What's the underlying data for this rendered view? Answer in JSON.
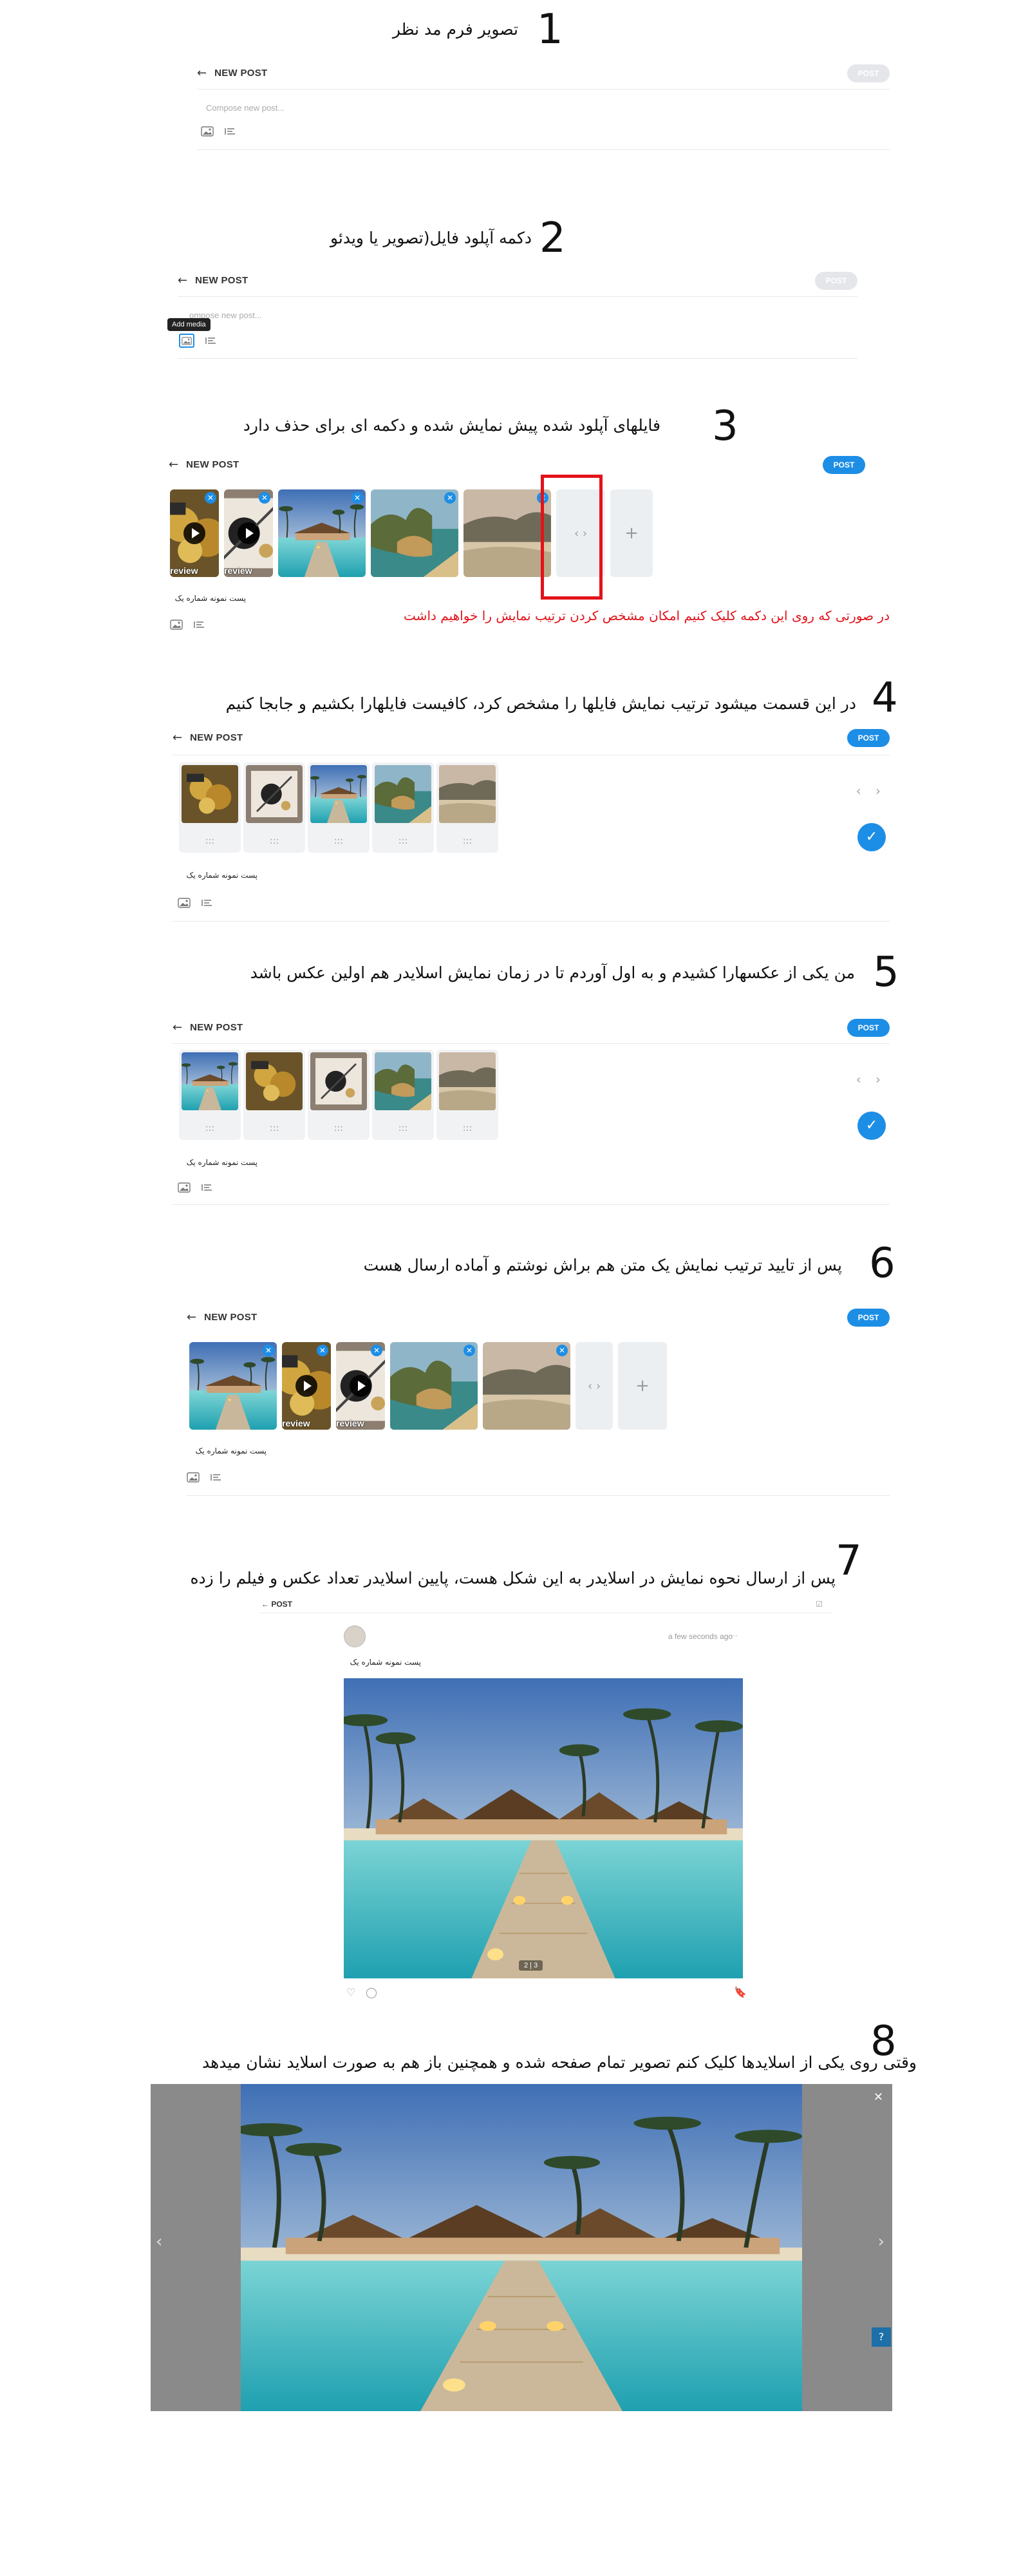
{
  "steps": [
    {
      "num": "1",
      "caption": "تصویر فرم مد نظر"
    },
    {
      "num": "2",
      "caption": "دکمه آپلود فایل(تصویر یا ویدئو"
    },
    {
      "num": "3",
      "caption": "فایلهای آپلود شده پیش نمایش شده و دکمه ای برای حذف دارد"
    },
    {
      "num": "4",
      "caption": "در این قسمت میشود ترتیب نمایش فایلها را مشخص کرد، کافیست فایلهارا بکشیم و جابجا کنیم"
    },
    {
      "num": "5",
      "caption": "من یکی از عکسهارا کشیدم و به اول آوردم تا در زمان نمایش اسلایدر هم اولین عکس باشد"
    },
    {
      "num": "6",
      "caption": "پس از تایید ترتیب نمایش یک متن هم براش نوشتم و آماده ارسال هست"
    },
    {
      "num": "7",
      "caption": "پس از ارسال نحوه نمایش در اسلایدر به این شکل هست، پایین اسلایدر تعداد عکس و فیلم را زده"
    },
    {
      "num": "8",
      "caption": "وقتی روی یکی از اسلایدها کلیک کنم تصویر تمام صفحه شده و همچنین باز هم به صورت اسلاید نشان میدهد"
    }
  ],
  "composer": {
    "title": "NEW POST",
    "post_button": "POST",
    "placeholder": "Compose new post...",
    "placeholder_truncated": "ompose new post...",
    "tooltip": "Add media",
    "post_text": "پست نمونه شماره یک",
    "preview_label": "review",
    "add_symbol": "+",
    "arrows_symbol": "‹ ›",
    "grip_symbol": ":::",
    "check_symbol": "✓",
    "close_symbol": "✕"
  },
  "annotation_note": "در صورتی که روی این دکمه کلیک کنیم امکان مشخص کردن ترتیب نمایش را خواهیم داشت",
  "feed": {
    "header": "POST",
    "time": "a few seconds ago",
    "more": "···",
    "post_text": "پست نمونه شماره یک",
    "counter": "2 | 3",
    "close": "✕",
    "prev": "‹",
    "next": "›",
    "help": "?"
  },
  "colors": {
    "accent": "#1d8ee6",
    "annotation_red": "#e3121a",
    "disabled": "#e4e6ea"
  },
  "icons": [
    "back-arrow-icon",
    "image-icon",
    "gif-icon",
    "close-icon",
    "play-icon",
    "pencil-icon",
    "arrows-icon",
    "plus-icon",
    "grip-icon",
    "check-icon",
    "heart-icon",
    "comment-icon",
    "bookmark-icon",
    "chevron-left-icon",
    "chevron-right-icon",
    "help-icon"
  ]
}
